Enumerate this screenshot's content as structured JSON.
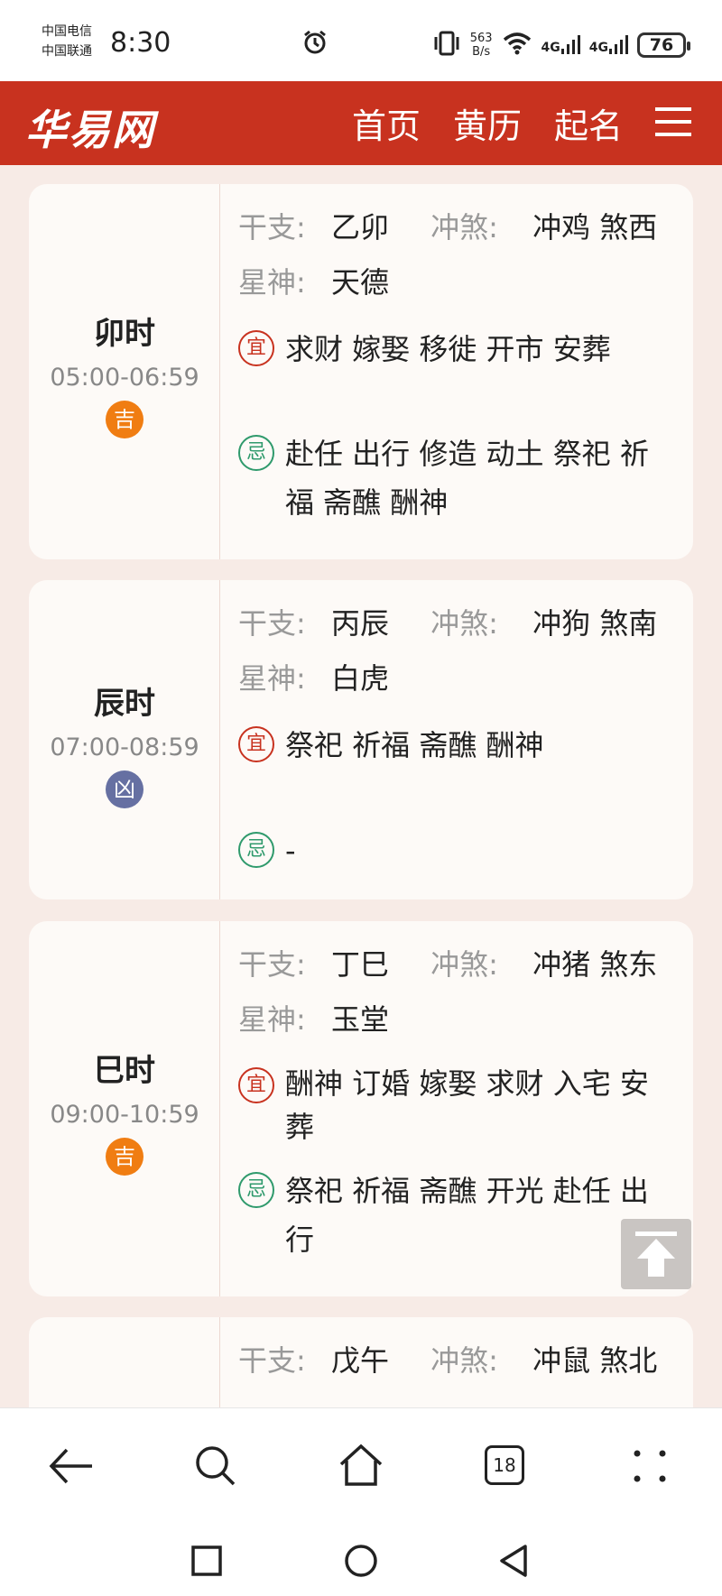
{
  "status_bar": {
    "carrier1": "中国电信",
    "carrier2": "中国联通",
    "time": "8:30",
    "speed_value": "563",
    "speed_unit": "B/s",
    "net1": "4G",
    "net2": "4G",
    "battery": "76"
  },
  "header": {
    "logo": "华易网",
    "nav": [
      "首页",
      "黄历",
      "起名"
    ]
  },
  "labels": {
    "ganzhi": "干支:",
    "chongsha": "冲煞:",
    "xingshen": "星神:",
    "yi": "宜",
    "ji": "忌"
  },
  "hours": [
    {
      "name": "卯时",
      "range": "05:00-06:59",
      "luck": "吉",
      "ganzhi": "乙卯",
      "chongsha": "冲鸡 煞西",
      "xingshen": "天德",
      "yi": "求财 嫁娶 移徙 开市 安葬",
      "ji_line1": "赴任 出行 修造 动土 祭祀 祈",
      "ji_line2": "福 斋醮 酬神"
    },
    {
      "name": "辰时",
      "range": "07:00-08:59",
      "luck": "凶",
      "ganzhi": "丙辰",
      "chongsha": "冲狗 煞南",
      "xingshen": "白虎",
      "yi": "祭祀 祈福 斋醮 酬神",
      "ji_line1": "-"
    },
    {
      "name": "巳时",
      "range": "09:00-10:59",
      "luck": "吉",
      "ganzhi": "丁巳",
      "chongsha": "冲猪 煞东",
      "xingshen": "玉堂",
      "yi_line1": "酬神 订婚 嫁娶 求财 入宅 安",
      "yi_line2": "葬",
      "ji_line1": "祭祀 祈福 斋醮 开光 赴任 出",
      "ji_line2": "行"
    },
    {
      "ganzhi": "戊午",
      "chongsha": "冲鼠 煞北"
    }
  ],
  "browser": {
    "tab_count": "18"
  },
  "colors": {
    "header_red": "#c8321f",
    "good_orange": "#f07d12",
    "bad_slate": "#6670a2",
    "yi_red": "#c8321f",
    "ji_green": "#2f9a6c"
  }
}
